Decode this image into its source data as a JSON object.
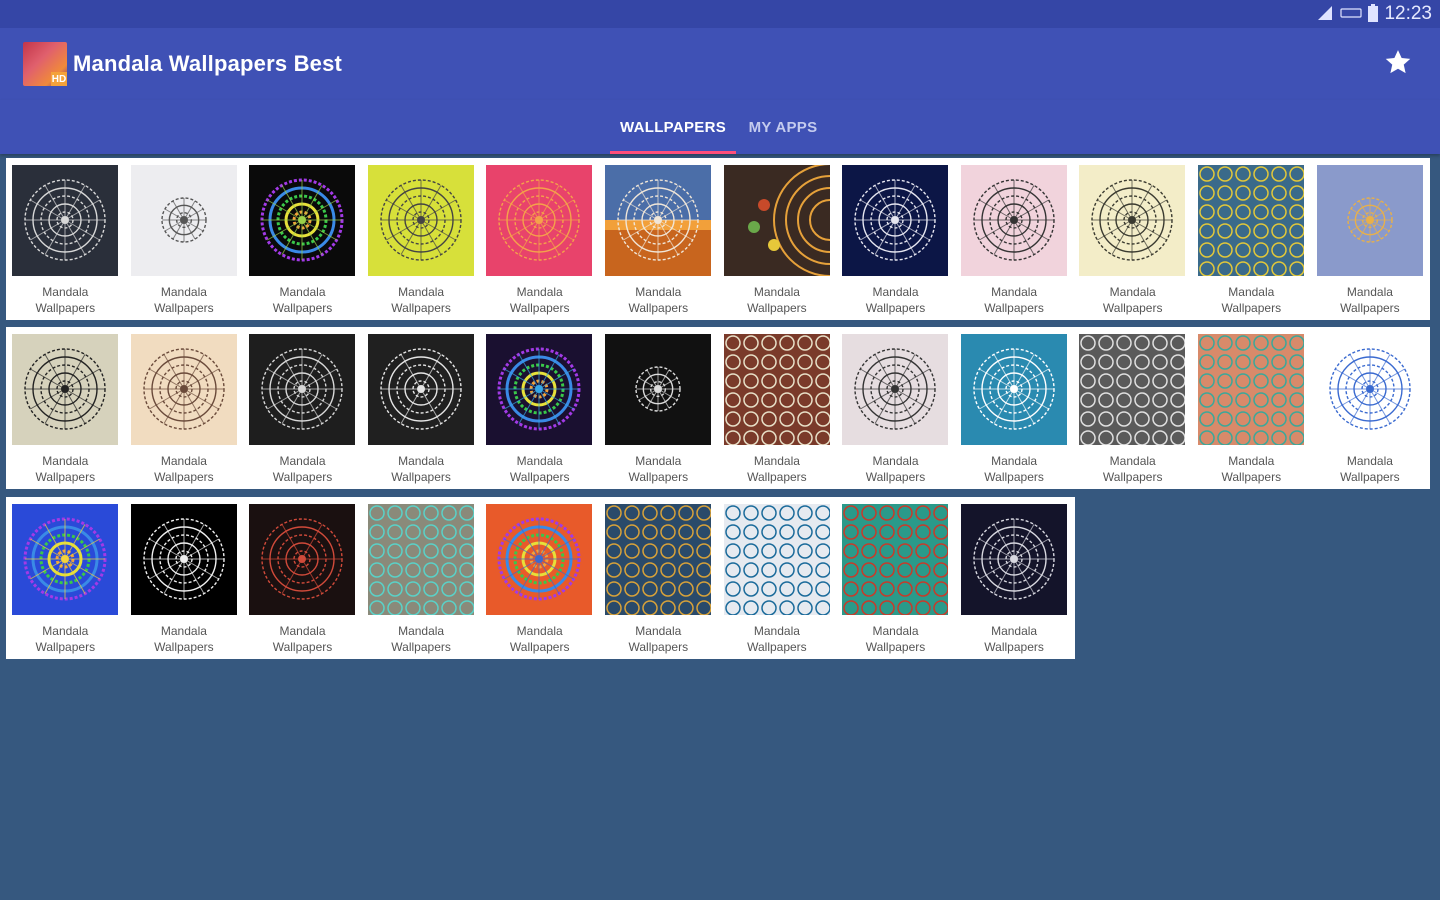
{
  "status_bar": {
    "clock": "12:23",
    "icons": [
      "signal-icon",
      "network-type-icon",
      "battery-icon"
    ]
  },
  "app_bar": {
    "title": "Mandala Wallpapers Best",
    "logo_badge": "HD",
    "action_icon": "star-icon"
  },
  "tabs": [
    {
      "label": "WALLPAPERS",
      "selected": true
    },
    {
      "label": "MY APPS",
      "selected": false
    }
  ],
  "colors": {
    "primary": "#3f51b5",
    "status_bar": "#3546a6",
    "background": "#36587f",
    "tab_indicator": "#ff4f7a"
  },
  "wallpapers": [
    {
      "line1": "Mandala",
      "line2": "Wallpapers",
      "bg": "#2a2f3a",
      "fg": "#d8d8d8",
      "style": "mandala"
    },
    {
      "line1": "Mandala",
      "line2": "Wallpapers",
      "bg": "#ededf0",
      "fg": "#555555",
      "style": "small"
    },
    {
      "line1": "Mandala",
      "line2": "Wallpapers",
      "bg": "#0a0a0a",
      "fg": "#9ad24a",
      "style": "rainbow"
    },
    {
      "line1": "Mandala",
      "line2": "Wallpapers",
      "bg": "#d7e03a",
      "fg": "#444444",
      "style": "mandala"
    },
    {
      "line1": "Mandala",
      "line2": "Wallpapers",
      "bg": "#e8436b",
      "fg": "#f4a24a",
      "style": "mandala"
    },
    {
      "line1": "Mandala",
      "line2": "Wallpapers",
      "bg": "#4b6ea8",
      "fg": "#f0e6d8",
      "style": "sunset"
    },
    {
      "line1": "Mandala",
      "line2": "Wallpapers",
      "bg": "#3a2a22",
      "fg": "#e6a13a",
      "style": "half"
    },
    {
      "line1": "Mandala",
      "line2": "Wallpapers",
      "bg": "#0c1646",
      "fg": "#e6e6f0",
      "style": "mandala"
    },
    {
      "line1": "Mandala",
      "line2": "Wallpapers",
      "bg": "#f1d3dc",
      "fg": "#333333",
      "style": "mandala"
    },
    {
      "line1": "Mandala",
      "line2": "Wallpapers",
      "bg": "#f3edc8",
      "fg": "#3a3a30",
      "style": "mandala"
    },
    {
      "line1": "Mandala",
      "line2": "Wallpapers",
      "bg": "#3a6a8a",
      "fg": "#e2c83a",
      "style": "pattern"
    },
    {
      "line1": "Mandala",
      "line2": "Wallpapers",
      "bg": "#8a9acb",
      "fg": "#e8b04a",
      "style": "small"
    },
    {
      "line1": "Mandala",
      "line2": "Wallpapers",
      "bg": "#d6d2bc",
      "fg": "#222222",
      "style": "mandala"
    },
    {
      "line1": "Mandala",
      "line2": "Wallpapers",
      "bg": "#f1dcc0",
      "fg": "#6a4a3a",
      "style": "mandala"
    },
    {
      "line1": "Mandala",
      "line2": "Wallpapers",
      "bg": "#1e1e1e",
      "fg": "#d8d8d8",
      "style": "mandala"
    },
    {
      "line1": "Mandala",
      "line2": "Wallpapers",
      "bg": "#202020",
      "fg": "#e6e6e6",
      "style": "star"
    },
    {
      "line1": "Mandala",
      "line2": "Wallpapers",
      "bg": "#1a1030",
      "fg": "#36a8e6",
      "style": "rainbow"
    },
    {
      "line1": "Mandala",
      "line2": "Wallpapers",
      "bg": "#111111",
      "fg": "#dcdcdc",
      "style": "small"
    },
    {
      "line1": "Mandala",
      "line2": "Wallpapers",
      "bg": "#7a3a2a",
      "fg": "#e8e0c8",
      "style": "pattern"
    },
    {
      "line1": "Mandala",
      "line2": "Wallpapers",
      "bg": "#e6dde0",
      "fg": "#333333",
      "style": "mandala"
    },
    {
      "line1": "Mandala",
      "line2": "Wallpapers",
      "bg": "#2a8ab0",
      "fg": "#ffffff",
      "style": "mandala"
    },
    {
      "line1": "Mandala",
      "line2": "Wallpapers",
      "bg": "#5a5a5a",
      "fg": "#e0e0e0",
      "style": "pattern"
    },
    {
      "line1": "Mandala",
      "line2": "Wallpapers",
      "bg": "#d88a6a",
      "fg": "#3aa89a",
      "style": "pattern"
    },
    {
      "line1": "Mandala",
      "line2": "Wallpapers",
      "bg": "#ffffff",
      "fg": "#3a6ad0",
      "style": "mandala"
    },
    {
      "line1": "Mandala",
      "line2": "Wallpapers",
      "bg": "#2a4ad8",
      "fg": "#f4d23a",
      "style": "rainbow"
    },
    {
      "line1": "Mandala",
      "line2": "Wallpapers",
      "bg": "#000000",
      "fg": "#f0f0f0",
      "style": "mandala"
    },
    {
      "line1": "Mandala",
      "line2": "Wallpapers",
      "bg": "#1a1010",
      "fg": "#d04a3a",
      "style": "star"
    },
    {
      "line1": "Mandala",
      "line2": "Wallpapers",
      "bg": "#8a8a7a",
      "fg": "#5ad2c8",
      "style": "pattern"
    },
    {
      "line1": "Mandala",
      "line2": "Wallpapers",
      "bg": "#e85a2a",
      "fg": "#3a6ad0",
      "style": "rainbow"
    },
    {
      "line1": "Mandala",
      "line2": "Wallpapers",
      "bg": "#2a4a6a",
      "fg": "#d8a23a",
      "style": "pattern"
    },
    {
      "line1": "Mandala",
      "line2": "Wallpapers",
      "bg": "#e6eaf0",
      "fg": "#1a6a9a",
      "style": "pattern"
    },
    {
      "line1": "Mandala",
      "line2": "Wallpapers",
      "bg": "#2a9a8a",
      "fg": "#c83a2a",
      "style": "pattern"
    },
    {
      "line1": "Mandala",
      "line2": "Wallpapers",
      "bg": "#14142a",
      "fg": "#d8d8e0",
      "style": "mandala"
    }
  ]
}
